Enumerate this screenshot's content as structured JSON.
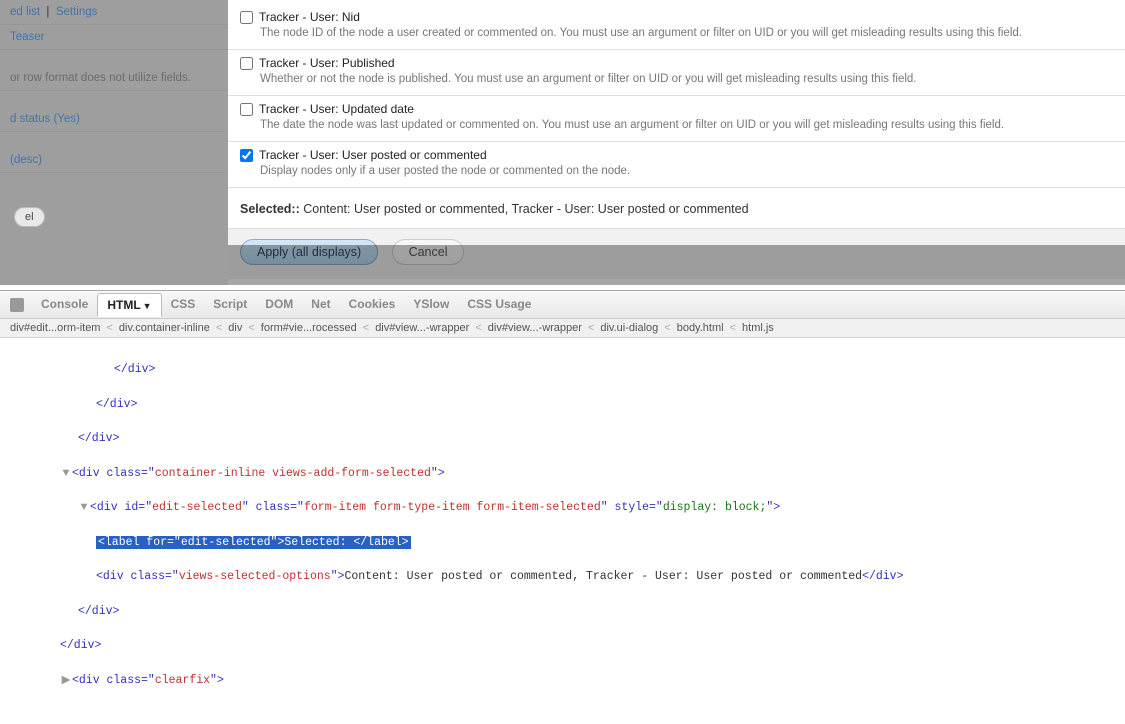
{
  "backdrop": {
    "top_links": [
      "ed list",
      "Settings"
    ],
    "teaser": "Teaser",
    "row_format_msg": "or row format does not utilize fields.",
    "status": "d status (Yes)",
    "desc": "(desc)",
    "cancel_btn": "el"
  },
  "fields": [
    {
      "label": "Tracker - User: Nid",
      "desc": "The node ID of the node a user created or commented on. You must use an argument or filter on UID or you will get misleading results using this field.",
      "checked": false
    },
    {
      "label": "Tracker - User: Published",
      "desc": "Whether or not the node is published. You must use an argument or filter on UID or you will get misleading results using this field.",
      "checked": false
    },
    {
      "label": "Tracker - User: Updated date",
      "desc": "The date the node was last updated or commented on. You must use an argument or filter on UID or you will get misleading results using this field.",
      "checked": false
    },
    {
      "label": "Tracker - User: User posted or commented",
      "desc": "Display nodes only if a user posted the node or commented on the node.",
      "checked": true
    }
  ],
  "selected": {
    "label": "Selected::",
    "value": "Content: User posted or commented, Tracker - User: User posted or commented"
  },
  "buttons": {
    "apply": "Apply (all displays)",
    "cancel": "Cancel"
  },
  "devtools": {
    "tabs": [
      "Console",
      "HTML",
      "CSS",
      "Script",
      "DOM",
      "Net",
      "Cookies",
      "YSlow",
      "CSS Usage"
    ],
    "crumbs": [
      "div#edit...orm-item",
      "div.container-inline",
      "div",
      "form#vie...rocessed",
      "div#view...-wrapper",
      "div#view...-wrapper",
      "div.ui-dialog",
      "body.html",
      "html.js"
    ],
    "code": {
      "l1": "</div>",
      "l2": "</div>",
      "l3": "</div>",
      "l4_open": "<div class=\"",
      "l4_cls": "container-inline views-add-form-selected",
      "l4_close": "\">",
      "l5_open": "<div id=\"",
      "l5_id": "edit-selected",
      "l5_mid": "\" class=\"",
      "l5_cls": "form-item form-type-item form-item-selected",
      "l5_style": "\" style=\"",
      "l5_styleval": "display: block;",
      "l5_close": "\">",
      "l6_open": "<label for=\"",
      "l6_for": "edit-selected",
      "l6_mid": "\">",
      "l6_text": "Selected: ",
      "l6_close": "</label>",
      "l7_open": "<div class=\"",
      "l7_cls": "views-selected-options",
      "l7_mid": "\">",
      "l7_text": "Content: User posted or commented, Tracker - User: User posted or commented",
      "l7_close": "</div>",
      "l8": "</div>",
      "l9": "</div>",
      "l10_open": "<div class=\"",
      "l10_cls": "clearfix",
      "l10_close": "\">"
    }
  }
}
